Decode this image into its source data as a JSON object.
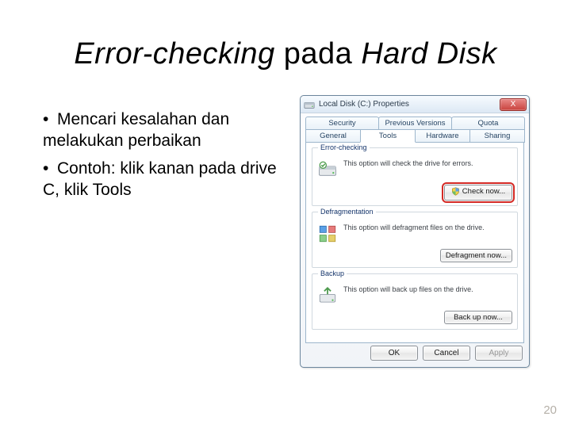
{
  "slide": {
    "title_italic1": "Error-checking",
    "title_mid": " pada ",
    "title_italic2": "Hard Disk",
    "bullet1": "Mencari kesalahan dan melakukan perbaikan",
    "bullet2": "Contoh: klik kanan pada drive C, klik Tools",
    "page_number": "20"
  },
  "window": {
    "title": "Local Disk (C:) Properties",
    "close": "X",
    "tabs_top": [
      "Security",
      "Previous Versions",
      "Quota"
    ],
    "tabs_bottom": [
      "General",
      "Tools",
      "Hardware",
      "Sharing"
    ],
    "active_tab": "Tools",
    "groups": {
      "error_checking": {
        "label": "Error-checking",
        "desc": "This option will check the drive for errors.",
        "button": "Check now..."
      },
      "defrag": {
        "label": "Defragmentation",
        "desc": "This option will defragment files on the drive.",
        "button": "Defragment now..."
      },
      "backup": {
        "label": "Backup",
        "desc": "This option will back up files on the drive.",
        "button": "Back up now..."
      }
    },
    "footer": {
      "ok": "OK",
      "cancel": "Cancel",
      "apply": "Apply"
    }
  }
}
